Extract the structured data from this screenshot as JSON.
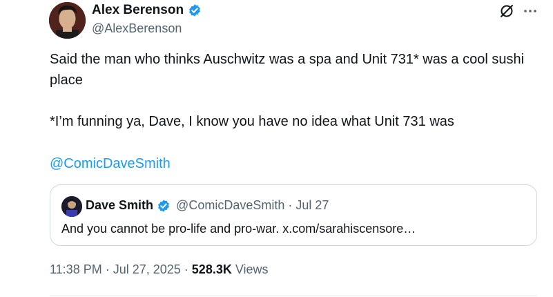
{
  "author": {
    "name": "Alex Berenson",
    "handle": "@AlexBerenson",
    "verified_color": "#1d9bf0"
  },
  "icons": {
    "grok": "grok-icon",
    "more": "more-options-icon"
  },
  "tweet": {
    "paragraph1": "Said the man who thinks Auschwitz was a spa and Unit 731* was a cool sushi place",
    "paragraph2": "*I’m funning ya, Dave, I know you have no idea what Unit 731 was",
    "mention": "@ComicDaveSmith"
  },
  "quoted_tweet": {
    "name": "Dave Smith",
    "handle": "@ComicDaveSmith",
    "separator": "·",
    "date": "Jul 27",
    "text": "And you cannot be pro-life and pro-war. x.com/sarahiscensore…"
  },
  "meta": {
    "time": "11:38 PM",
    "separator": "·",
    "date": "Jul 27, 2025",
    "separator2": "·",
    "views_count": "528.3K",
    "views_label": "Views"
  },
  "colors": {
    "link": "#1d9bf0",
    "secondary_text": "#536471",
    "border": "#cfd9de"
  }
}
